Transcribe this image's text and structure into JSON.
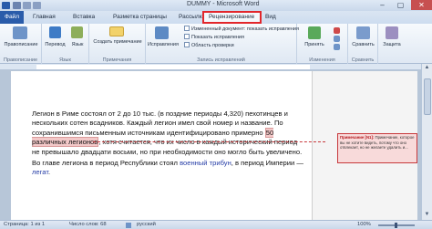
{
  "window": {
    "title": "DUMMY - Microsoft Word",
    "minimize": "‒",
    "maximize": "▢",
    "close": "✕"
  },
  "tabs": [
    "Файл",
    "Главная",
    "Вставка",
    "Разметка страницы",
    "Рассылки",
    "Рецензирование",
    "Вид"
  ],
  "ribbon": {
    "proofing": {
      "spell": "Правописание",
      "label": "Правописание"
    },
    "language": {
      "translate": "Перевод",
      "lang": "Язык",
      "label": "Язык"
    },
    "comments": {
      "create": "Создать примечание",
      "label": "Примечания"
    },
    "tracking": {
      "fixes": "Исправления",
      "markup_option": "Измененный документ: показать исправления",
      "show_fixes": "Показать исправления",
      "review_pane": "Область проверки",
      "label": "Запись исправлений"
    },
    "changes": {
      "accept": "Принять",
      "label": "Изменения"
    },
    "compare": {
      "compare": "Сравнить",
      "label": "Сравнить"
    },
    "protect": {
      "protect": "Защита",
      "label": ""
    }
  },
  "document": {
    "paragraph1_before": "Легион в Риме состоял от 2 до 10 тыс. (в поздние периоды 4,320) пехотинцев и нескольких сотен всадников. Каждый легион имел свой номер и название. По сохранившимся письменным источникам идентифицировано примерно ",
    "paragraph1_highlight": "50 различных легионов",
    "paragraph1_after": ", хотя считается, что их число в каждый исторический период не превышало двадцати восьми, но при необходимости оно могло быть увеличено.",
    "paragraph2_before": "Во главе легиона в период Республики стоял ",
    "paragraph2_link1": "военный трибун",
    "paragraph2_mid": ", в период Империи — ",
    "paragraph2_link2": "легат",
    "paragraph2_end": "."
  },
  "comment": {
    "head": "Примечание [N1]:",
    "body": "Примечание, которое вы не хотите видеть, потому что оно отвлекает, но не желаете удалить и..."
  },
  "status": {
    "page": "Страница: 1 из 1",
    "words": "Число слов: 68",
    "lang": "русский",
    "zoom": "100%"
  },
  "colors": {
    "accent": "#2a5caa",
    "highlight_box": "#e2262b",
    "comment_border": "#c7393c"
  }
}
